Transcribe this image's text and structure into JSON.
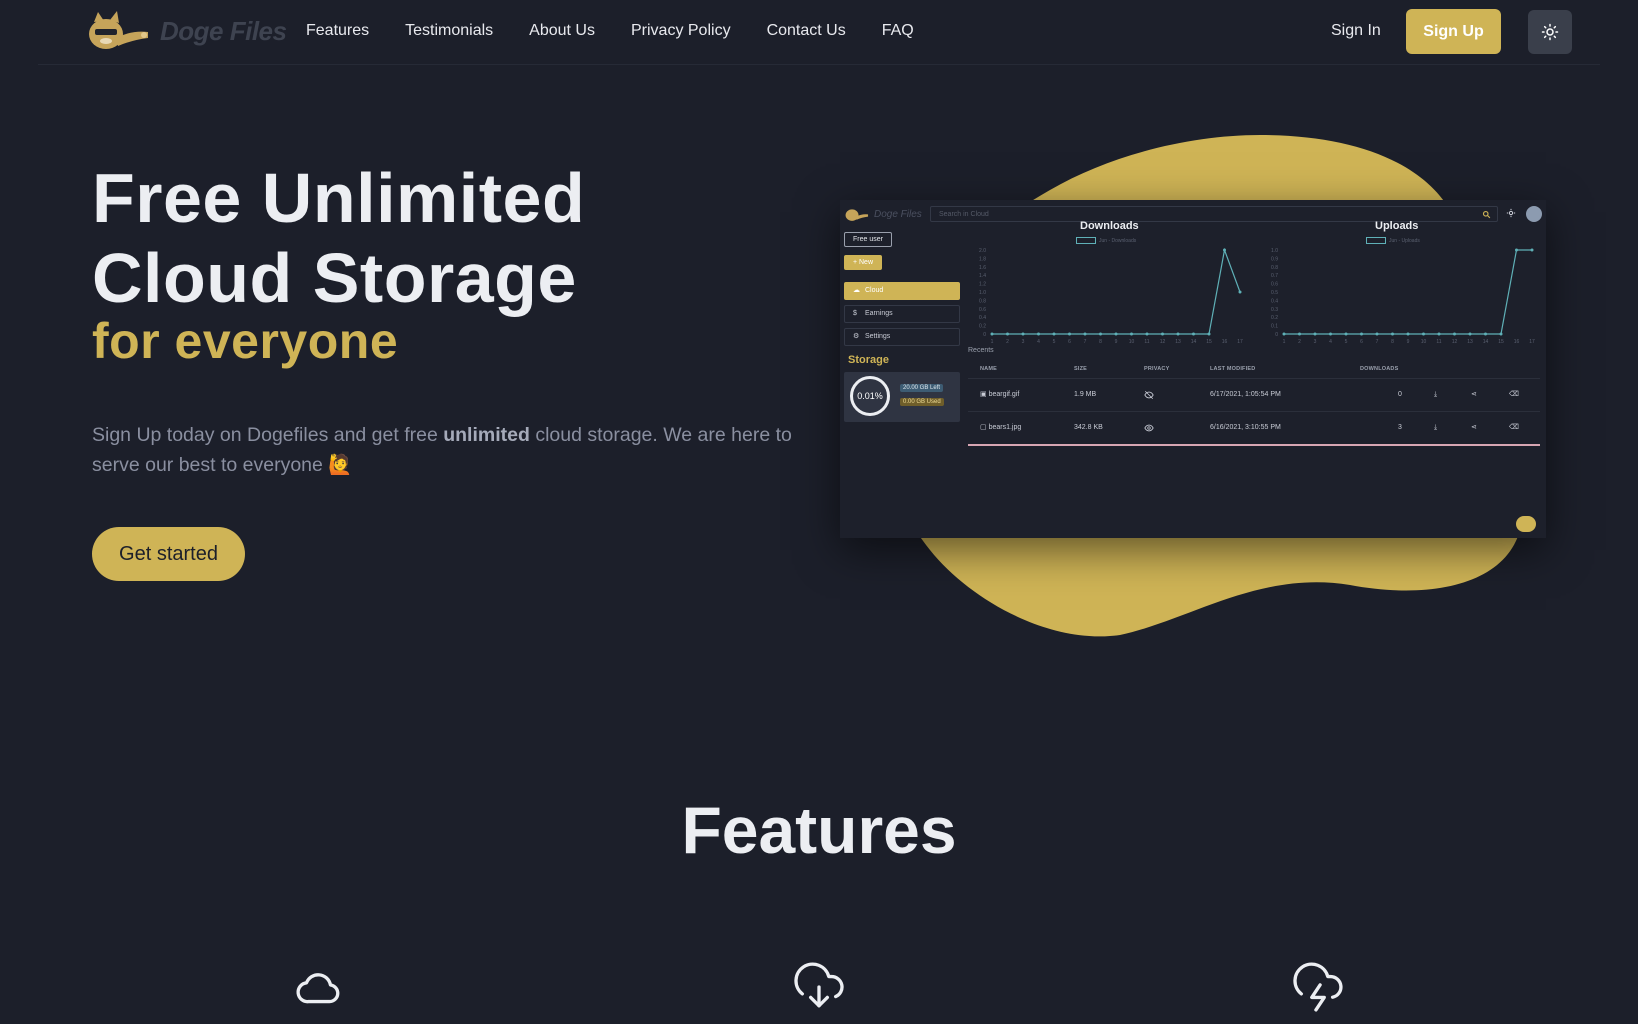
{
  "brand": {
    "name": "Doge Files"
  },
  "nav": {
    "links": [
      "Features",
      "Testimonials",
      "About Us",
      "Privacy Policy",
      "Contact Us",
      "FAQ"
    ],
    "signin": "Sign In",
    "signup": "Sign Up",
    "theme_icon": "sun-icon"
  },
  "hero": {
    "title_line1": "Free Unlimited",
    "title_line2": "Cloud Storage",
    "accent": "for everyone",
    "desc_before": "Sign Up today on Dogefiles and get free ",
    "desc_bold": "unlimited",
    "desc_after": " cloud storage. We are here to serve our best to everyone 🙋",
    "cta": "Get started"
  },
  "preview": {
    "brand": "Doge Files",
    "search_placeholder": "Search in Cloud",
    "badge": "Free user",
    "new_label": "+ New",
    "menu": [
      {
        "label": "Cloud",
        "icon": "cloud-icon",
        "active": true
      },
      {
        "label": "Earnings",
        "icon": "dollar-icon",
        "active": false
      },
      {
        "label": "Settings",
        "icon": "gear-icon",
        "active": false
      }
    ],
    "storage": {
      "title": "Storage",
      "percent": "0.01%",
      "left": "20.00 GB Left",
      "used": "0.00 GB Used"
    },
    "recents_label": "Recents",
    "columns": [
      "NAME",
      "SIZE",
      "PRIVACY",
      "LAST MODIFIED",
      "DOWNLOADS"
    ],
    "rows": [
      {
        "name": "beargif.gif",
        "size": "1.9 MB",
        "privacy": "eye-off-icon",
        "modified": "6/17/2021, 1:05:54 PM",
        "downloads": "0"
      },
      {
        "name": "bears1.jpg",
        "size": "342.8 KB",
        "privacy": "eye-icon",
        "modified": "6/16/2021, 3:10:55 PM",
        "downloads": "3"
      }
    ],
    "row_action_icons": [
      "download-icon",
      "share-icon",
      "delete-icon"
    ]
  },
  "chart_data": [
    {
      "type": "line",
      "title": "Downloads",
      "legend": "Jun - Downloads",
      "x": [
        1,
        2,
        3,
        4,
        5,
        6,
        7,
        8,
        9,
        10,
        11,
        12,
        13,
        14,
        15,
        16,
        17
      ],
      "series": [
        {
          "name": "Jun - Downloads",
          "values": [
            0,
            0,
            0,
            0,
            0,
            0,
            0,
            0,
            0,
            0,
            0,
            0,
            0,
            0,
            0,
            2,
            1
          ]
        }
      ],
      "ylim": [
        0,
        2
      ],
      "yticks": [
        "0",
        "0.2",
        "0.4",
        "0.6",
        "0.8",
        "1.0",
        "1.2",
        "1.4",
        "1.6",
        "1.8",
        "2.0"
      ],
      "line_color": "#5fb0b7"
    },
    {
      "type": "line",
      "title": "Uploads",
      "legend": "Jun - Uploads",
      "x": [
        1,
        2,
        3,
        4,
        5,
        6,
        7,
        8,
        9,
        10,
        11,
        12,
        13,
        14,
        15,
        16,
        17
      ],
      "series": [
        {
          "name": "Jun - Uploads",
          "values": [
            0,
            0,
            0,
            0,
            0,
            0,
            0,
            0,
            0,
            0,
            0,
            0,
            0,
            0,
            0,
            1,
            1
          ]
        }
      ],
      "ylim": [
        0,
        1
      ],
      "yticks": [
        "0",
        "0.1",
        "0.2",
        "0.3",
        "0.4",
        "0.5",
        "0.6",
        "0.7",
        "0.8",
        "0.9",
        "1.0"
      ],
      "line_color": "#5fb0b7"
    }
  ],
  "features": {
    "title": "Features",
    "icons": [
      "cloud-icon",
      "cloud-download-icon",
      "cloud-lightning-icon"
    ]
  },
  "colors": {
    "background": "#1c1f2a",
    "accent": "#cfb456",
    "text": "#eceef2",
    "muted": "#8a8fa0"
  }
}
